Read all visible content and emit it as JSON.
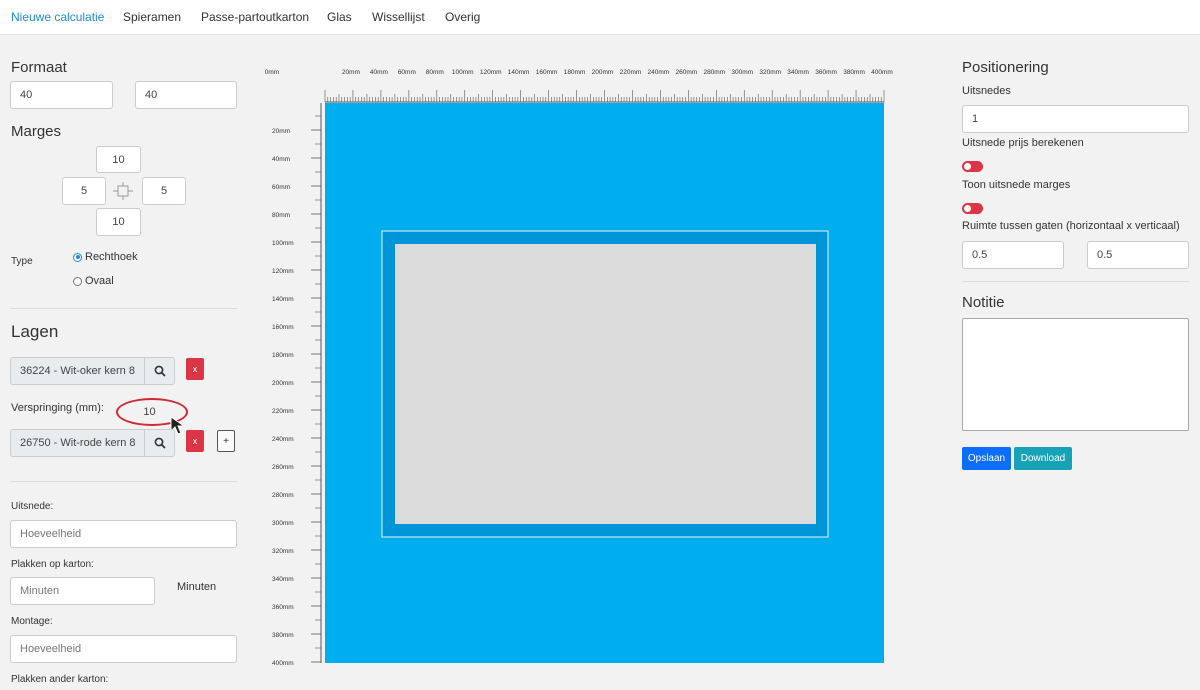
{
  "nav": {
    "tabs": [
      {
        "label": "Nieuwe calculatie",
        "active": true
      },
      {
        "label": "Spieramen"
      },
      {
        "label": "Passe-partoutkarton"
      },
      {
        "label": "Glas"
      },
      {
        "label": "Wissellijst"
      },
      {
        "label": "Overig"
      }
    ]
  },
  "formaat": {
    "title": "Formaat",
    "width": "40",
    "height": "40"
  },
  "marges": {
    "title": "Marges",
    "top": "10",
    "left": "5",
    "right": "5",
    "bottom": "10"
  },
  "type": {
    "label": "Type",
    "options": [
      "Rechthoek",
      "Ovaal"
    ],
    "selected": "Rechthoek"
  },
  "lagen": {
    "title": "Lagen",
    "layer1": "36224 - Wit-oker kern 8",
    "verspringing_label": "Verspringing (mm):",
    "verspringing_value": "10",
    "layer2": "26750 - Wit-rode kern 8",
    "remove_label": "x",
    "add_label": "+"
  },
  "extras": {
    "uitsnede_label": "Uitsnede:",
    "uitsnede_placeholder": "Hoeveelheid",
    "plakken_label": "Plakken op karton:",
    "plakken_placeholder": "Minuten",
    "plakken_unit": "Minuten",
    "montage_label": "Montage:",
    "montage_placeholder": "Hoeveelheid",
    "plakken_ander_label": "Plakken ander karton:"
  },
  "ruler": {
    "top_labels": [
      "0mm",
      "20mm",
      "40mm",
      "60mm",
      "80mm",
      "100mm",
      "120mm",
      "140mm",
      "160mm",
      "180mm",
      "200mm",
      "220mm",
      "240mm",
      "260mm",
      "280mm",
      "300mm",
      "320mm",
      "340mm",
      "360mm",
      "380mm",
      "400mm"
    ],
    "left_labels": [
      "20mm",
      "40mm",
      "60mm",
      "80mm",
      "100mm",
      "120mm",
      "140mm",
      "160mm",
      "180mm",
      "200mm",
      "220mm",
      "240mm",
      "260mm",
      "280mm",
      "300mm",
      "320mm",
      "340mm",
      "360mm",
      "380mm",
      "400mm"
    ]
  },
  "colors": {
    "board": "#00aeef",
    "inner_layer": "#0095d9",
    "opening": "#dcdcdc",
    "accent": "#1e88e5",
    "danger": "#dc3545"
  },
  "positionering": {
    "title": "Positionering",
    "uitsnedes_label": "Uitsnedes",
    "uitsnedes_value": "1",
    "prijs_label": "Uitsnede prijs berekenen",
    "marges_label": "Toon uitsnede marges",
    "ruimte_label": "Ruimte tussen gaten (horizontaal x verticaal)",
    "ruimte_h": "0.5",
    "ruimte_v": "0.5"
  },
  "notitie": {
    "title": "Notitie",
    "value": ""
  },
  "actions": {
    "save": "Opslaan",
    "download": "Download"
  }
}
